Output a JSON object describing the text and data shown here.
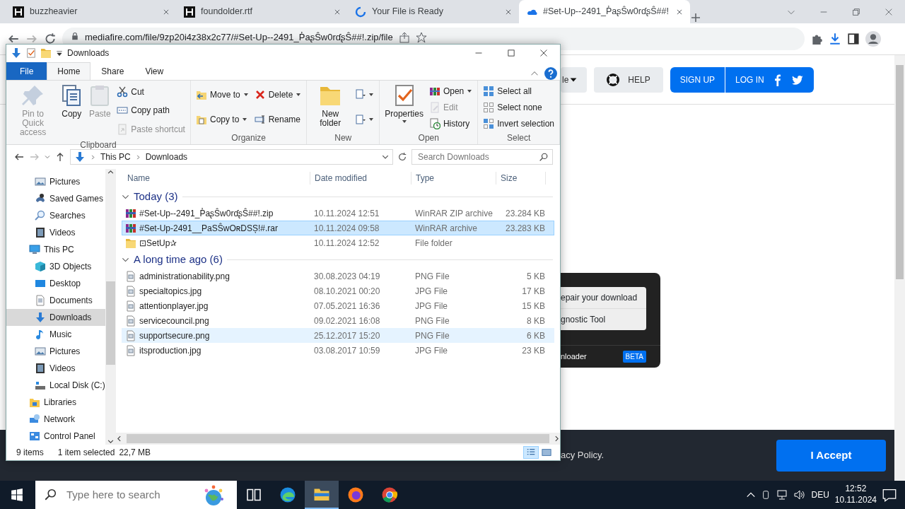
{
  "browser": {
    "tabs": [
      {
        "title": "buzzheavier",
        "kind": "letter",
        "selected": false
      },
      {
        "title": "foundolder.rtf",
        "kind": "letter",
        "selected": false
      },
      {
        "title": "Your File is Ready",
        "kind": "spinner",
        "selected": false
      },
      {
        "title": "#Set-Up--2491_P̓aʂŜw0rɗʂŜ##!",
        "kind": "cloud",
        "selected": true
      }
    ],
    "address": "mediafire.com/file/9zp20i4z38x2c77/#Set-Up--2491_P̓aʂŜw0rɗʂŜ##!.zip/file",
    "page": {
      "menu_button": "le",
      "help_button": "HELP",
      "sign_up": "SIGN UP",
      "log_in": "LOG IN",
      "card": {
        "links": [
          "epair your download",
          "gnostic Tool"
        ],
        "footer_text": "nloader",
        "badge": "BETA"
      },
      "footer": {
        "text": "acy Policy.",
        "accept_button": "I Accept"
      }
    }
  },
  "explorer": {
    "title": "Downloads",
    "ribbon_tabs": [
      {
        "label": "File",
        "kind": "file",
        "selected": false
      },
      {
        "label": "Home",
        "kind": "tab",
        "selected": true
      },
      {
        "label": "Share",
        "kind": "tab",
        "selected": false
      },
      {
        "label": "View",
        "kind": "tab",
        "selected": false
      }
    ],
    "ribbon_groups": [
      {
        "label": "Clipboard",
        "commands": [
          {
            "label": "Pin to Quick access",
            "kind": "pin",
            "disabled": true
          },
          {
            "label": "Copy",
            "kind": "copy",
            "disabled": false
          },
          {
            "label": "Paste",
            "kind": "paste",
            "disabled": true
          },
          {
            "label": "Cut",
            "kind": "cut",
            "disabled": false
          },
          {
            "label": "Copy path",
            "kind": "path",
            "disabled": false
          },
          {
            "label": "Paste shortcut",
            "kind": "shortcut",
            "disabled": true
          }
        ]
      },
      {
        "label": "Organize",
        "commands": [
          {
            "label": "Move to",
            "kind": "moveto",
            "disabled": false
          },
          {
            "label": "Copy to",
            "kind": "copyto",
            "disabled": false
          },
          {
            "label": "Delete",
            "kind": "delete",
            "disabled": false
          },
          {
            "label": "Rename",
            "kind": "rename",
            "disabled": false
          }
        ]
      },
      {
        "label": "New",
        "commands": [
          {
            "label": "New folder",
            "kind": "folder",
            "disabled": false
          },
          {
            "kind": "newitem",
            "disabled": false
          },
          {
            "kind": "easyaccess",
            "disabled": false
          }
        ]
      },
      {
        "label": "Open",
        "commands": [
          {
            "label": "Properties",
            "kind": "properties",
            "disabled": false
          },
          {
            "label": "Open",
            "kind": "open",
            "disabled": false
          },
          {
            "label": "Edit",
            "kind": "edit",
            "disabled": true
          },
          {
            "label": "History",
            "kind": "history",
            "disabled": false
          }
        ]
      },
      {
        "label": "Select",
        "commands": [
          {
            "label": "Select all",
            "kind": "selectall",
            "disabled": false
          },
          {
            "label": "Select none",
            "kind": "selectnone",
            "disabled": false
          },
          {
            "label": "Invert selection",
            "kind": "invert",
            "disabled": false
          }
        ]
      }
    ],
    "breadcrumbs": [
      "This PC",
      "Downloads"
    ],
    "search": {
      "placeholder": "Search Downloads"
    },
    "nav_pane": {
      "continued_children": [
        {
          "label": "Pictures",
          "kind": "pictures",
          "selected": false
        },
        {
          "label": "Saved Games",
          "kind": "games",
          "selected": false
        },
        {
          "label": "Searches",
          "kind": "search",
          "selected": false
        },
        {
          "label": "Videos",
          "kind": "video",
          "selected": false
        }
      ],
      "items": [
        {
          "label": "This PC",
          "kind": "pc",
          "selected": false,
          "children": [
            {
              "label": "3D Objects",
              "kind": "cube",
              "selected": false
            },
            {
              "label": "Desktop",
              "kind": "desktop",
              "selected": false
            },
            {
              "label": "Documents",
              "kind": "docs",
              "selected": false
            },
            {
              "label": "Downloads",
              "kind": "download",
              "selected": true
            },
            {
              "label": "Music",
              "kind": "music",
              "selected": false
            },
            {
              "label": "Pictures",
              "kind": "pictures",
              "selected": false
            },
            {
              "label": "Videos",
              "kind": "video",
              "selected": false
            },
            {
              "label": "Local Disk (C:)",
              "kind": "disk",
              "selected": false
            }
          ]
        },
        {
          "label": "Libraries",
          "kind": "libraries",
          "selected": false
        },
        {
          "label": "Network",
          "kind": "network",
          "selected": false
        },
        {
          "label": "Control Panel",
          "kind": "control",
          "selected": false
        }
      ]
    },
    "columns": [
      "Name",
      "Date modified",
      "Type",
      "Size"
    ],
    "groups": [
      {
        "label": "Today (3)",
        "expanded": true,
        "rows": [
          {
            "name": "#Set-Up--2491_P̓aʂŜw0rɗʂŜ##!.zip",
            "date": "10.11.2024 12:51",
            "type": "WinRAR ZIP archive",
            "size": "23.284 KB",
            "kind": "archive",
            "selected": false,
            "hovered": false
          },
          {
            "name": "#Set-Up-2491__PaSŜwOʀDSȘ!#.rar",
            "date": "10.11.2024 09:58",
            "type": "WinRAR archive",
            "size": "23.283 KB",
            "kind": "archive",
            "selected": true,
            "hovered": false
          },
          {
            "name": "⊡SetUp✰",
            "date": "10.11.2024 12:52",
            "type": "File folder",
            "kind": "folder",
            "selected": false,
            "hovered": false
          }
        ]
      },
      {
        "label": "A long time ago (6)",
        "expanded": true,
        "rows": [
          {
            "name": "administrationability.png",
            "date": "30.08.2023 04:19",
            "type": "PNG File",
            "size": "5 KB",
            "kind": "file",
            "selected": false,
            "hovered": false
          },
          {
            "name": "specialtopics.jpg",
            "date": "08.10.2021 00:20",
            "type": "JPG File",
            "size": "17 KB",
            "kind": "file",
            "selected": false,
            "hovered": false
          },
          {
            "name": "attentionplayer.jpg",
            "date": "07.05.2021 16:36",
            "type": "JPG File",
            "size": "15 KB",
            "kind": "file",
            "selected": false,
            "hovered": false
          },
          {
            "name": "servicecouncil.png",
            "date": "09.02.2021 16:08",
            "type": "PNG File",
            "size": "8 KB",
            "kind": "file",
            "selected": false,
            "hovered": false
          },
          {
            "name": "supportsecure.png",
            "date": "25.12.2017 15:20",
            "type": "PNG File",
            "size": "6 KB",
            "kind": "file",
            "selected": false,
            "hovered": true
          },
          {
            "name": "itsproduction.jpg",
            "date": "03.08.2017 10:59",
            "type": "JPG File",
            "size": "23 KB",
            "kind": "file",
            "selected": false,
            "hovered": false
          }
        ]
      }
    ],
    "status": {
      "count": "9 items",
      "selection": "1 item selected",
      "size": "22,7 MB"
    },
    "views": [
      {
        "kind": "details",
        "selected": true
      },
      {
        "kind": "large",
        "selected": false
      }
    ]
  },
  "taskbar": {
    "search_placeholder": "Type here to search",
    "apps": [
      {
        "kind": "taskview",
        "active": false
      },
      {
        "kind": "edge",
        "active": false
      },
      {
        "kind": "explorer",
        "active": true
      },
      {
        "kind": "firefox",
        "active": false
      },
      {
        "kind": "chrome",
        "active": false
      }
    ],
    "language": "DEU",
    "time": "12:52",
    "date": "10.11.2024"
  }
}
